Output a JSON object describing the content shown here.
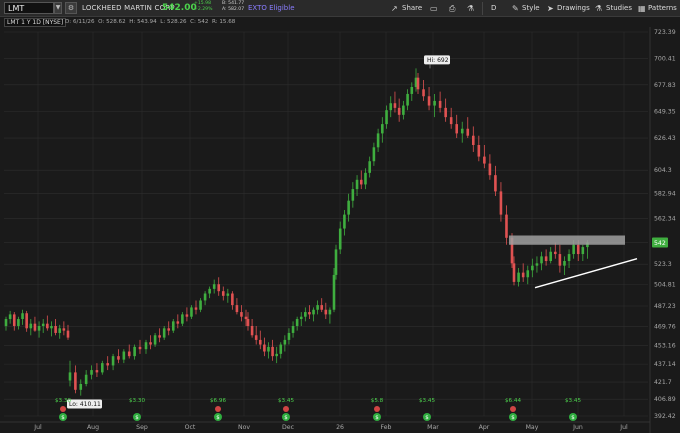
{
  "toolbar": {
    "symbol": "LMT",
    "company": "LOCKHEED MARTIN CORP",
    "last_price": "542.00",
    "change": "+15.98",
    "change_pct": "+2.29%",
    "bid": "B: 541.77",
    "ask": "A: 582.07",
    "exto": "EXTO Eligible",
    "share": "Share",
    "period": "D",
    "style": "Style",
    "drawings": "Drawings",
    "studies": "Studies",
    "patterns": "Patterns"
  },
  "chart_header": {
    "label": "LMT 1 Y 1D [NYSE]",
    "date": "D: 6/11/26",
    "open": "O: 528.62",
    "high": "H: 543.94",
    "low": "L: 528.26",
    "close": "C: 542",
    "range": "R: 15.68"
  },
  "colors": {
    "up": "#3fae3f",
    "down": "#e05252",
    "background": "#1a1a1a",
    "grid": "#2e2e2e",
    "trendline": "#ffffff",
    "resistance": "#a0a0a0"
  },
  "chart_data": {
    "type": "candlestick",
    "ylim": [
      392.42,
      723.39
    ],
    "y_ticks": [
      723.39,
      700.41,
      677.83,
      654.66,
      632.0,
      604.3,
      584.22,
      562.74,
      542,
      523.3,
      505.66,
      487.23,
      469.76,
      453.16,
      437.14,
      421.7,
      406.89,
      392.42
    ],
    "y_tick_labels": [
      "723.39",
      "700.41",
      "677.83",
      "649.35",
      "626.43",
      "604.3",
      "582.94",
      "562.34",
      "542",
      "523.3",
      "504.81",
      "487.23",
      "469.76",
      "453.16",
      "437.14",
      "421.7",
      "406.89",
      "392.42"
    ],
    "x_labels": [
      "Jul",
      "Aug",
      "Sep",
      "Oct",
      "Nov",
      "Dec",
      "26",
      "Feb",
      "Mar",
      "Apr",
      "May",
      "Jun",
      "Jul"
    ],
    "current_price_label": "542",
    "high_label": "Hi: 692",
    "low_label": "Lo: 410.11",
    "dividends": [
      "$3.30",
      "$3.30",
      "$6.96",
      "$3.45",
      "$5.8",
      "$3.45",
      "$6.44",
      "$3.45"
    ],
    "series": [
      {
        "values": [
          [
            470,
            478,
            466,
            476
          ],
          [
            476,
            483,
            472,
            480
          ],
          [
            480,
            482,
            466,
            470
          ],
          [
            470,
            478,
            467,
            476
          ],
          [
            476,
            484,
            471,
            481
          ],
          [
            481,
            483,
            465,
            468
          ],
          [
            468,
            476,
            462,
            472
          ],
          [
            472,
            478,
            465,
            466
          ],
          [
            466,
            474,
            460,
            470
          ],
          [
            470,
            476,
            464,
            472
          ],
          [
            472,
            479,
            466,
            468
          ],
          [
            468,
            474,
            461,
            470
          ],
          [
            470,
            476,
            462,
            464
          ],
          [
            464,
            471,
            459,
            468
          ],
          [
            468,
            474,
            462,
            466
          ],
          [
            466,
            471,
            458,
            460
          ],
          [
            423,
            440,
            418,
            430
          ],
          [
            430,
            436,
            412,
            415
          ],
          [
            415,
            424,
            410,
            420
          ],
          [
            420,
            432,
            418,
            428
          ],
          [
            428,
            436,
            424,
            432
          ],
          [
            432,
            438,
            426,
            430
          ],
          [
            430,
            440,
            428,
            438
          ],
          [
            438,
            444,
            432,
            436
          ],
          [
            436,
            446,
            432,
            444
          ],
          [
            444,
            450,
            438,
            441
          ],
          [
            441,
            450,
            438,
            448
          ],
          [
            448,
            454,
            442,
            444
          ],
          [
            444,
            454,
            441,
            452
          ],
          [
            452,
            458,
            446,
            450
          ],
          [
            450,
            458,
            446,
            456
          ],
          [
            456,
            462,
            450,
            454
          ],
          [
            454,
            464,
            452,
            462
          ],
          [
            462,
            468,
            456,
            460
          ],
          [
            460,
            470,
            458,
            468
          ],
          [
            468,
            474,
            462,
            466
          ],
          [
            466,
            476,
            464,
            474
          ],
          [
            474,
            480,
            468,
            472
          ],
          [
            472,
            482,
            470,
            480
          ],
          [
            480,
            486,
            474,
            478
          ],
          [
            478,
            488,
            476,
            486
          ],
          [
            486,
            492,
            480,
            484
          ],
          [
            484,
            494,
            482,
            492
          ],
          [
            492,
            500,
            488,
            498
          ],
          [
            498,
            504,
            494,
            502
          ],
          [
            502,
            510,
            498,
            506
          ],
          [
            506,
            512,
            496,
            500
          ],
          [
            500,
            504,
            492,
            496
          ],
          [
            496,
            502,
            490,
            498
          ],
          [
            498,
            500,
            484,
            488
          ],
          [
            488,
            494,
            480,
            482
          ],
          [
            482,
            488,
            474,
            478
          ],
          [
            478,
            484,
            470,
            476
          ],
          [
            476,
            482,
            466,
            470
          ],
          [
            470,
            476,
            460,
            462
          ],
          [
            462,
            470,
            454,
            458
          ],
          [
            458,
            466,
            450,
            454
          ],
          [
            454,
            460,
            444,
            448
          ],
          [
            448,
            456,
            442,
            452
          ],
          [
            452,
            458,
            440,
            444
          ],
          [
            444,
            452,
            438,
            446
          ],
          [
            446,
            456,
            442,
            454
          ],
          [
            454,
            462,
            448,
            458
          ],
          [
            458,
            468,
            454,
            464
          ],
          [
            464,
            474,
            460,
            470
          ],
          [
            470,
            478,
            466,
            476
          ],
          [
            476,
            482,
            470,
            478
          ],
          [
            478,
            486,
            474,
            482
          ],
          [
            482,
            488,
            476,
            480
          ],
          [
            480,
            486,
            474,
            484
          ],
          [
            484,
            492,
            480,
            488
          ],
          [
            488,
            494,
            482,
            484
          ],
          [
            484,
            490,
            476,
            480
          ],
          [
            480,
            486,
            472,
            484
          ],
          [
            484,
            520,
            482,
            514
          ],
          [
            514,
            540,
            510,
            536
          ],
          [
            536,
            560,
            532,
            554
          ],
          [
            554,
            570,
            548,
            566
          ],
          [
            566,
            584,
            560,
            578
          ],
          [
            578,
            594,
            572,
            588
          ],
          [
            588,
            600,
            582,
            596
          ],
          [
            596,
            604,
            588,
            592
          ],
          [
            592,
            606,
            588,
            602
          ],
          [
            602,
            616,
            598,
            612
          ],
          [
            612,
            628,
            608,
            624
          ],
          [
            624,
            640,
            620,
            636
          ],
          [
            636,
            650,
            628,
            644
          ],
          [
            644,
            660,
            640,
            656
          ],
          [
            656,
            668,
            650,
            662
          ],
          [
            662,
            672,
            654,
            658
          ],
          [
            658,
            666,
            646,
            652
          ],
          [
            652,
            664,
            648,
            660
          ],
          [
            660,
            674,
            656,
            670
          ],
          [
            670,
            680,
            664,
            676
          ],
          [
            676,
            692,
            672,
            684
          ],
          [
            684,
            688,
            670,
            674
          ],
          [
            674,
            682,
            664,
            668
          ],
          [
            668,
            676,
            656,
            660
          ],
          [
            660,
            670,
            650,
            664
          ],
          [
            664,
            672,
            654,
            658
          ],
          [
            658,
            666,
            646,
            650
          ],
          [
            650,
            658,
            640,
            644
          ],
          [
            644,
            652,
            632,
            636
          ],
          [
            636,
            646,
            628,
            640
          ],
          [
            640,
            650,
            632,
            634
          ],
          [
            634,
            642,
            620,
            626
          ],
          [
            626,
            634,
            612,
            616
          ],
          [
            616,
            626,
            606,
            610
          ],
          [
            610,
            618,
            596,
            600
          ],
          [
            600,
            608,
            582,
            586
          ],
          [
            586,
            594,
            560,
            566
          ],
          [
            566,
            574,
            540,
            546
          ],
          [
            546,
            550,
            520,
            524
          ],
          [
            524,
            530,
            505,
            508
          ],
          [
            508,
            520,
            504,
            516
          ],
          [
            516,
            524,
            508,
            512
          ],
          [
            512,
            522,
            506,
            518
          ],
          [
            518,
            528,
            512,
            522
          ],
          [
            522,
            530,
            516,
            524
          ],
          [
            524,
            534,
            518,
            530
          ],
          [
            530,
            536,
            522,
            526
          ],
          [
            526,
            538,
            524,
            534
          ],
          [
            534,
            542,
            528,
            532
          ],
          [
            532,
            540,
            516,
            522
          ],
          [
            522,
            530,
            514,
            526
          ],
          [
            526,
            536,
            520,
            532
          ],
          [
            532,
            544,
            528,
            540
          ],
          [
            540,
            544,
            526,
            532
          ],
          [
            532,
            540,
            526,
            538
          ],
          [
            538,
            544,
            528,
            542
          ]
        ]
      }
    ]
  }
}
